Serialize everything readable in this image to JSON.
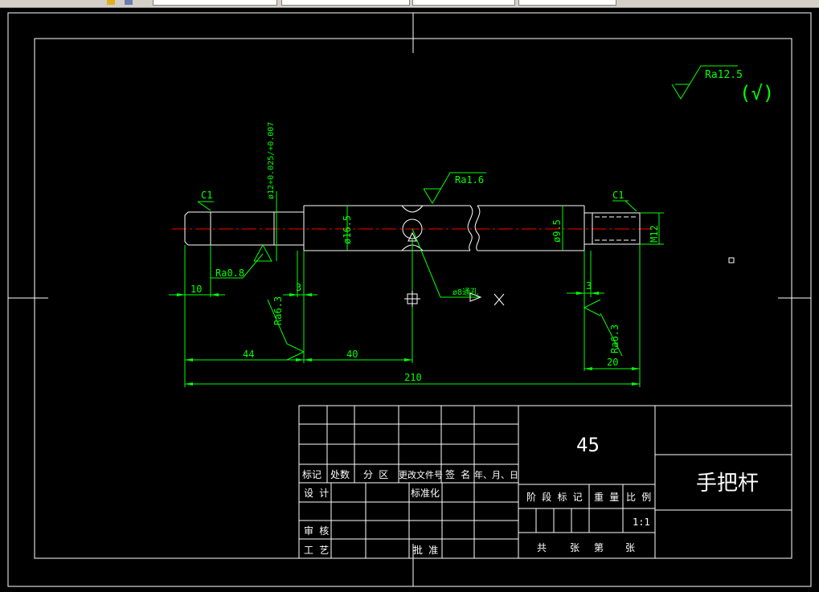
{
  "toolbar": {
    "fields": [
      "",
      "",
      "",
      ""
    ]
  },
  "drawing": {
    "surface_finish_general": "Ra12.5",
    "surface_finish_general_symbol": "(√)",
    "chamfer_left": "C1",
    "chamfer_right": "C1",
    "roughness_top": "Ra1.6",
    "roughness_left_diameter": "Ra0.8",
    "roughness_left_shoulder": "Ra6.3",
    "roughness_right_shoulder": "Ra6.3",
    "dim_d12_tolerance": "ø12+0.025/+0.007",
    "dim_d16_5": "ø16.5",
    "dim_d9_5": "ø9.5",
    "dim_m12": "M12",
    "dim_hole": "ø8通孔",
    "dim_10": "10",
    "dim_3_left": "3",
    "dim_3_right": "3",
    "dim_44": "44",
    "dim_40": "40",
    "dim_20": "20",
    "dim_210": "210"
  },
  "title_block": {
    "material": "45",
    "part_name": "手把杆",
    "col_mark": "标记",
    "col_count": "处数",
    "col_zone": "分 区",
    "col_docno": "更改文件号",
    "col_sign": "签 名",
    "col_date": "年、月、日",
    "row_design": "设 计",
    "row_standard": "标准化",
    "row_review": "审 核",
    "row_process": "工 艺",
    "row_approve": "批 准",
    "stage_mark": "阶 段 标 记",
    "weight": "重 量",
    "scale_label": "比 例",
    "scale_value": "1:1",
    "sheets_total": "共",
    "sheets_unit1": "张",
    "sheet_no": "第",
    "sheets_unit2": "张"
  }
}
